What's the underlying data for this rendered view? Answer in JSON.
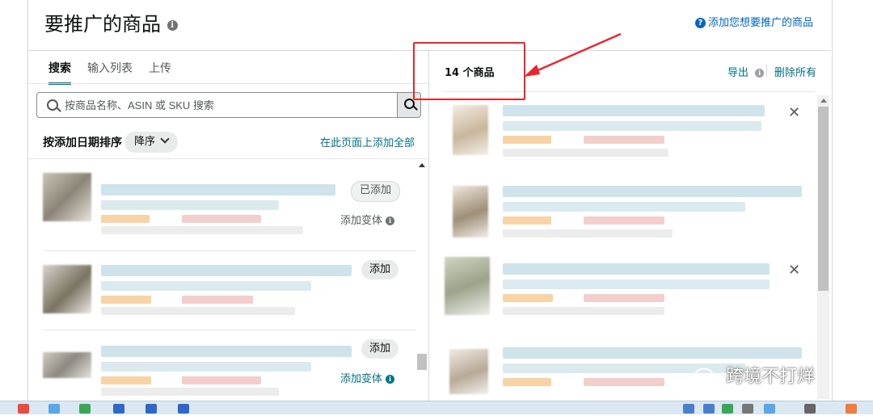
{
  "header": {
    "title": "要推广的商品",
    "help_link": "添加您想要推广的商品"
  },
  "tabs": [
    {
      "label": "搜索",
      "active": true
    },
    {
      "label": "输入列表",
      "active": false
    },
    {
      "label": "上传",
      "active": false
    }
  ],
  "search": {
    "placeholder": "按商品名称、ASIN 或 SKU 搜索",
    "value": ""
  },
  "sort": {
    "label": "按添加日期排序",
    "selected": "降序",
    "add_all": "在此页面上添加全部"
  },
  "left_items": [
    {
      "button": "已添加",
      "variant": "添加变体",
      "variant_style": "muted"
    },
    {
      "button": "添加",
      "variant": "",
      "variant_style": "muted"
    },
    {
      "button": "添加",
      "variant": "添加变体",
      "variant_style": "link"
    }
  ],
  "right_panel": {
    "count": "14 个商品",
    "export": "导出",
    "clear_all": "删除所有"
  },
  "watermark": "跨境不打烊",
  "colors": {
    "link": "#007185",
    "help_link": "#0066c0",
    "annotation_red": "#e8262c",
    "tab_underline": "#007185"
  }
}
